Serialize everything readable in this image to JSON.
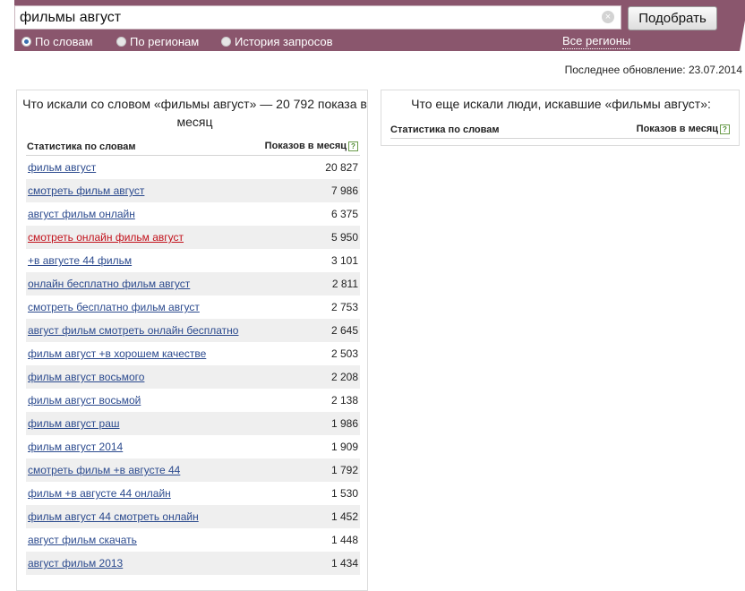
{
  "search": {
    "query": "фильмы август",
    "submit_label": "Подобрать",
    "modes": [
      {
        "label": "По словам",
        "selected": true
      },
      {
        "label": "По регионам",
        "selected": false
      },
      {
        "label": "История запросов",
        "selected": false
      }
    ],
    "all_regions_label": "Все регионы"
  },
  "updated_text": "Последнее обновление: 23.07.2014",
  "left_panel": {
    "title": "Что искали со словом «фильмы август» — 20 792 показа в месяц",
    "col_phrase": "Статистика по словам",
    "col_count": "Показов в месяц",
    "rows": [
      {
        "phrase": "фильм август",
        "count": "20 827"
      },
      {
        "phrase": "смотреть фильм август",
        "count": "7 986"
      },
      {
        "phrase": "август фильм онлайн",
        "count": "6 375"
      },
      {
        "phrase": "смотреть онлайн фильм август",
        "count": "5 950",
        "visited": true
      },
      {
        "phrase": "+в августе 44 фильм",
        "count": "3 101"
      },
      {
        "phrase": "онлайн бесплатно фильм август",
        "count": "2 811"
      },
      {
        "phrase": "смотреть бесплатно фильм август",
        "count": "2 753"
      },
      {
        "phrase": "август фильм смотреть онлайн бесплатно",
        "count": "2 645"
      },
      {
        "phrase": "фильм август +в хорошем качестве",
        "count": "2 503"
      },
      {
        "phrase": "фильм август восьмого",
        "count": "2 208"
      },
      {
        "phrase": "фильм август восьмой",
        "count": "2 138"
      },
      {
        "phrase": "фильм август раш",
        "count": "1 986"
      },
      {
        "phrase": "фильм август 2014",
        "count": "1 909"
      },
      {
        "phrase": "смотреть фильм +в августе 44",
        "count": "1 792"
      },
      {
        "phrase": "фильм +в августе 44 онлайн",
        "count": "1 530"
      },
      {
        "phrase": "фильм август 44 смотреть онлайн",
        "count": "1 452"
      },
      {
        "phrase": "август фильм скачать",
        "count": "1 448"
      },
      {
        "phrase": "август фильм 2013",
        "count": "1 434"
      }
    ]
  },
  "right_panel": {
    "title": "Что еще искали люди, искавшие «фильмы август»:",
    "col_phrase": "Статистика по словам",
    "col_count": "Показов в месяц"
  },
  "colors": {
    "header_bg": "#8a566d",
    "link": "#2b4a8e",
    "visited_link": "#c2111b",
    "alt_row": "#efefef"
  }
}
